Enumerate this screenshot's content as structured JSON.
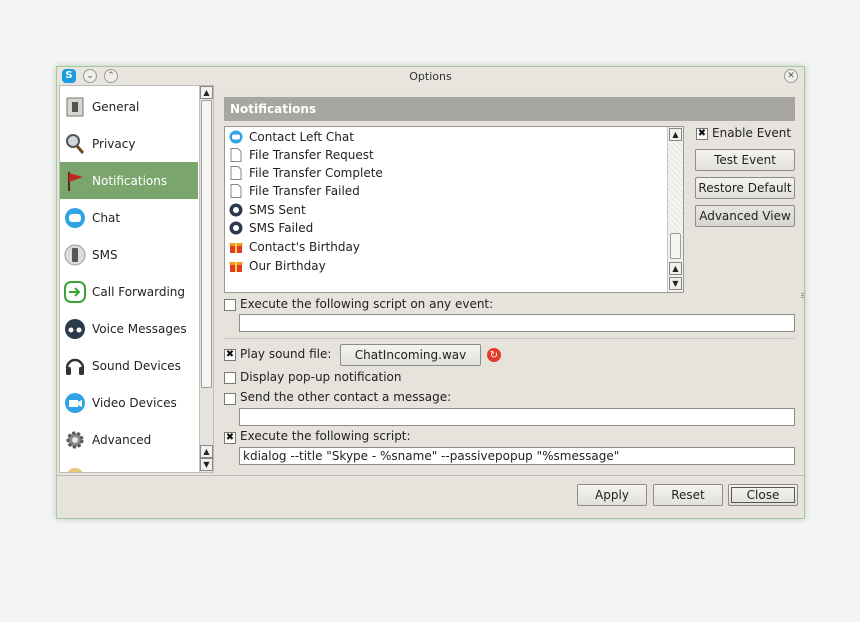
{
  "window": {
    "title": "Options"
  },
  "sidebar": {
    "items": [
      {
        "label": "General",
        "icon": "general-icon"
      },
      {
        "label": "Privacy",
        "icon": "privacy-icon"
      },
      {
        "label": "Notifications",
        "icon": "flag-icon",
        "active": true
      },
      {
        "label": "Chat",
        "icon": "chat-bubble-icon"
      },
      {
        "label": "SMS",
        "icon": "phone-icon"
      },
      {
        "label": "Call Forwarding",
        "icon": "forward-arrow-icon"
      },
      {
        "label": "Voice Messages",
        "icon": "voicemail-icon"
      },
      {
        "label": "Sound Devices",
        "icon": "headset-icon"
      },
      {
        "label": "Video Devices",
        "icon": "webcam-icon"
      },
      {
        "label": "Advanced",
        "icon": "gear-icon"
      }
    ]
  },
  "panel": {
    "title": "Notifications"
  },
  "events": [
    {
      "label": "Contact Left Chat",
      "icon": "chat-bubble-icon"
    },
    {
      "label": "File Transfer Request",
      "icon": "document-icon"
    },
    {
      "label": "File Transfer Complete",
      "icon": "document-icon"
    },
    {
      "label": "File Transfer Failed",
      "icon": "document-icon"
    },
    {
      "label": "SMS Sent",
      "icon": "sms-icon"
    },
    {
      "label": "SMS Failed",
      "icon": "sms-icon"
    },
    {
      "label": "Contact's Birthday",
      "icon": "gift-icon"
    },
    {
      "label": "Our Birthday",
      "icon": "gift-icon"
    }
  ],
  "side_actions": {
    "enable_event": {
      "label": "Enable Event",
      "checked": true
    },
    "test_event": "Test Event",
    "restore_default": "Restore Default",
    "advanced_view": "Advanced View"
  },
  "options": {
    "script_any_event": {
      "label": "Execute the following script on any event:",
      "checked": false,
      "value": ""
    },
    "play_sound": {
      "label": "Play sound file:",
      "checked": true,
      "file": "ChatIncoming.wav"
    },
    "popup": {
      "label": "Display pop-up notification",
      "checked": false
    },
    "send_message": {
      "label": "Send the other contact a message:",
      "checked": false,
      "value": ""
    },
    "execute_script": {
      "label": "Execute the following script:",
      "checked": true,
      "value": "kdialog --title \"Skype - %sname\" --passivepopup \"%smessage\""
    }
  },
  "footer": {
    "apply": "Apply",
    "reset": "Reset",
    "close": "Close"
  },
  "colors": {
    "accent": "#7aa66e",
    "header": "#a8a6a1",
    "window_bg": "#e6e3dd"
  }
}
